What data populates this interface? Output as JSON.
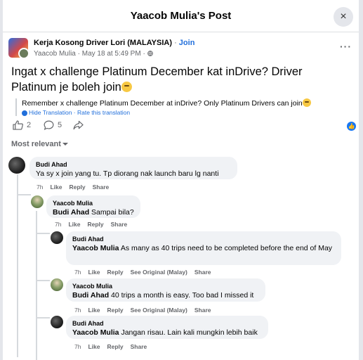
{
  "header": {
    "title": "Yaacob Mulia's Post",
    "close_icon": "×"
  },
  "post": {
    "group_name": "Kerja Kosong Driver Lori (MALAYSIA)",
    "separator": " · ",
    "join_label": "Join",
    "author": "Yaacob Mulia",
    "time": " · May 18 at 5:49 PM · ",
    "more_label": "···",
    "text": "Ingat x challenge Platinum December kat inDrive? Driver Platinum je boleh join",
    "translation": "Remember x challenge Platinum December at inDrive? Only Platinum Drivers can join",
    "hide_translation": "Hide Translation",
    "rate_translation": "Rate this translation",
    "link_sep": " · "
  },
  "actions": {
    "likes": "2",
    "comments": "5"
  },
  "sort": {
    "label": "Most relevant"
  },
  "comments": [
    {
      "name": "Budi Ahad",
      "tag": "",
      "text": "Ya sy x join yang tu. Tp diorang nak launch baru lg nanti",
      "time": "7h",
      "like": "Like",
      "reply": "Reply",
      "share": "Share"
    },
    {
      "name": "Yaacob Mulia",
      "tag": "Budi Ahad",
      "text": " Sampai bila?",
      "time": "7h",
      "like": "Like",
      "reply": "Reply",
      "share": "Share"
    },
    {
      "name": "Budi Ahad",
      "tag": "Yaacob Mulia",
      "text": " As many as 40 trips need to be completed before the end of May",
      "time": "7h",
      "like": "Like",
      "reply": "Reply",
      "see_original": "See Original (Malay)",
      "share": "Share"
    },
    {
      "name": "Yaacob Mulia",
      "tag": "Budi Ahad",
      "text": " 40 trips a month is easy. Too bad I missed it",
      "time": "7h",
      "like": "Like",
      "reply": "Reply",
      "see_original": "See Original (Malay)",
      "share": "Share"
    },
    {
      "name": "Budi Ahad",
      "tag": "Yaacob Mulia",
      "text": " Jangan risau. Lain kali mungkin lebih baik",
      "time": "7h",
      "like": "Like",
      "reply": "Reply",
      "share": "Share"
    }
  ]
}
